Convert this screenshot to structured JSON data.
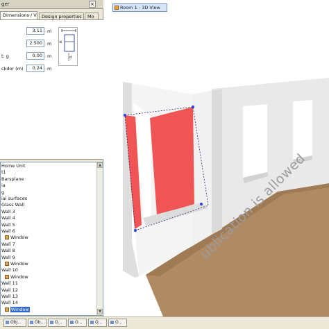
{
  "panel": {
    "title": "ger",
    "close": "×",
    "tabs": [
      "Dimensions / Views",
      "Design properties",
      "Mo"
    ],
    "props": [
      {
        "label": "",
        "value": "3.11",
        "unit": "m"
      },
      {
        "label": "",
        "value": "2.500",
        "unit": "m"
      },
      {
        "label": "t: g",
        "value": "0.00",
        "unit": "m"
      },
      {
        "label": "ckdor (m)",
        "value": "0.24",
        "unit": "m"
      }
    ],
    "diagram": {
      "left": "b",
      "bottom": "d"
    }
  },
  "tree": {
    "items": [
      {
        "text": "Home Unit",
        "icon": false,
        "selected": false
      },
      {
        "text": "t1",
        "icon": false,
        "selected": false
      },
      {
        "text": "Barsplane",
        "icon": false,
        "selected": false
      },
      {
        "text": "ia",
        "icon": false,
        "selected": false
      },
      {
        "text": "g",
        "icon": false,
        "selected": false
      },
      {
        "text": "ial surfaces",
        "icon": false,
        "selected": false
      },
      {
        "text": "Glass Wall",
        "icon": false,
        "selected": false
      },
      {
        "text": "Wall 3",
        "icon": false,
        "selected": false
      },
      {
        "text": "Wall 4",
        "icon": false,
        "selected": false
      },
      {
        "text": "Wall 5",
        "icon": false,
        "selected": false
      },
      {
        "text": "Wall 6",
        "icon": false,
        "selected": false
      },
      {
        "text": "Window",
        "icon": true,
        "selected": false
      },
      {
        "text": "Wall 7",
        "icon": false,
        "selected": false
      },
      {
        "text": "Wall 8",
        "icon": false,
        "selected": false
      },
      {
        "text": "Wall 9",
        "icon": false,
        "selected": false
      },
      {
        "text": "Window",
        "icon": true,
        "selected": false
      },
      {
        "text": "Wall 10",
        "icon": false,
        "selected": false
      },
      {
        "text": "Window",
        "icon": true,
        "selected": false
      },
      {
        "text": "Wall 11",
        "icon": false,
        "selected": false
      },
      {
        "text": "Wall 12",
        "icon": false,
        "selected": false
      },
      {
        "text": "Wall 13",
        "icon": false,
        "selected": false
      },
      {
        "text": "Wall 14",
        "icon": false,
        "selected": false
      },
      {
        "text": "Window",
        "icon": true,
        "selected": true
      }
    ],
    "scroll_up": "▲",
    "scroll_down": "▼"
  },
  "viewport": {
    "tab_label": "Room 1 - 3D View"
  },
  "taskbar": {
    "items": [
      "Obj...",
      "Ob...",
      "O...",
      "O...",
      "O...",
      "O..."
    ]
  },
  "watermark": "ublication is allowed",
  "colors": {
    "selection_red": "#f05555",
    "floor_wood": "#b08a62",
    "wall": "#e4e4e4",
    "highlight": "#316ac5"
  }
}
